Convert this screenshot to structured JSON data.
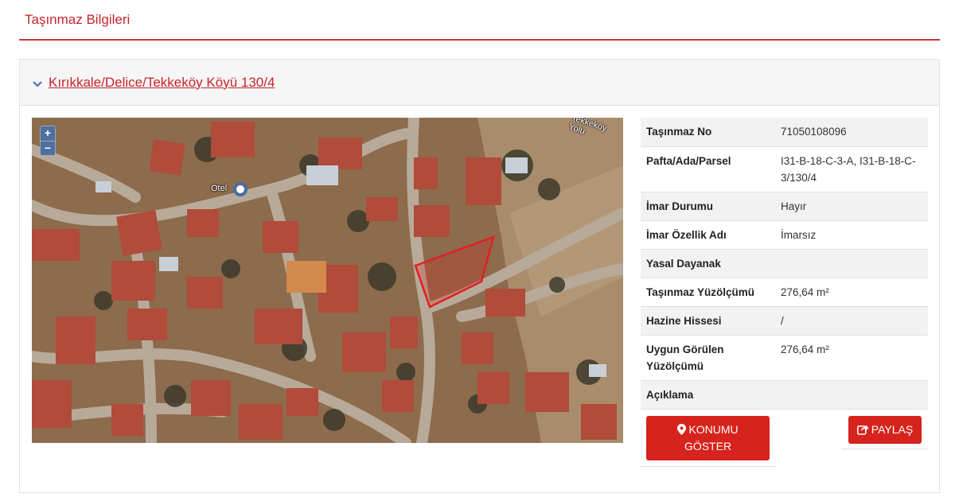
{
  "page": {
    "title": "Taşınmaz Bilgileri"
  },
  "property": {
    "location_link": "Kırıkkale/Delice/Tekkeköy Köyü 130/4"
  },
  "map": {
    "zoom_in_label": "+",
    "zoom_out_label": "−",
    "labels": {
      "otel": "Otel",
      "road": "Tekkeköy Yolu"
    }
  },
  "info_rows": [
    {
      "key": "Taşınmaz No",
      "value": "71050108096"
    },
    {
      "key": "Pafta/Ada/Parsel",
      "value": "I31-B-18-C-3-A, I31-B-18-C-3/130/4"
    },
    {
      "key": "İmar Durumu",
      "value": "Hayır"
    },
    {
      "key": "İmar Özellik Adı",
      "value": "İmarsız"
    },
    {
      "key": "Yasal Dayanak",
      "value": ""
    },
    {
      "key": "Taşınmaz Yüzölçümü",
      "value": "276,64 m²"
    },
    {
      "key": "Hazine Hissesi",
      "value": "/"
    },
    {
      "key": "Uygun Görülen Yüzölçümü",
      "value": "276,64 m²"
    },
    {
      "key": "Açıklama",
      "value": ""
    }
  ],
  "actions": {
    "konum_line1": "KONUMU",
    "konum_line2": "GÖSTER",
    "paylas": "PAYLAŞ"
  },
  "colors": {
    "accent": "#c8232c",
    "button": "#d7231d",
    "parcel_outline": "#e02020"
  },
  "icons": {
    "header_toggle": "chevron-down-icon",
    "konum": "map-marker-icon",
    "paylas": "share-icon"
  }
}
